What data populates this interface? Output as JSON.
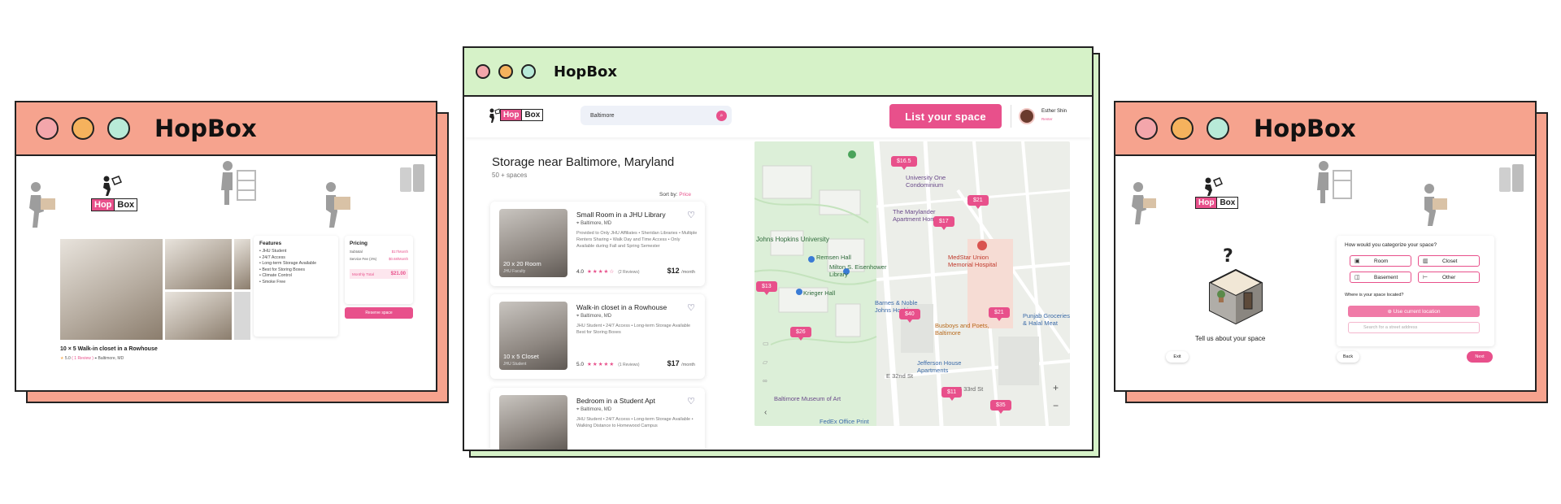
{
  "colors": {
    "brand_pink": "#e8508b",
    "salmon_window": "#f6a38e",
    "green_window": "#d6f2c8"
  },
  "logo": {
    "hop": "Hop",
    "box": "Box"
  },
  "left_window": {
    "title": "HopBox",
    "listing_title": "10 × 5 Walk-in closet in a Rowhouse",
    "listing_rating": "5.0",
    "listing_reviews": "1 Review",
    "listing_location": "Baltimore, MD",
    "features_title": "Features",
    "features": [
      "JHU Student",
      "24/7 Access",
      "Long-term Storage Available",
      "Best for Storing Boxes",
      "Climate Control",
      "Smoke Free"
    ],
    "pricing_title": "Pricing",
    "pricing_rows": [
      {
        "label": "Subtotal",
        "value": "$17/Month"
      },
      {
        "label": "Service Fee (4%)",
        "value": "$0.68/Month"
      }
    ],
    "pricing_total_label": "Monthly Total",
    "pricing_total_value": "$21.00",
    "reserve_label": "Reserve space"
  },
  "center_window": {
    "title": "HopBox",
    "search_value": "Baltimore",
    "search_icon": "search-icon",
    "list_space_label": "List your space",
    "user_name": "Esther Shin",
    "user_role": "Renter",
    "heading": "Storage near Baltimore, Maryland",
    "subheading": "50 + spaces",
    "sort_label": "Sort by:",
    "sort_value": "Price",
    "listings": [
      {
        "title": "Small Room in a JHU Library",
        "location": "Baltimore, MD",
        "description": "Provided to Only JHU Affiliates • Sheridan Libraries • Multiple Renters Sharing • Walk Day and Time Access • Only Available during Fall and Spring Semester",
        "rating": "4.0",
        "stars": "★★★★☆",
        "reviews": "(2 Reviews)",
        "price": "$12",
        "per": "/month",
        "thumb_caption": "20 x 20 Room",
        "thumb_sub": "JHU Faculty"
      },
      {
        "title": "Walk-in closet in a Rowhouse",
        "location": "Baltimore, MD",
        "description": "JHU Student • 24/7 Access • Long-term Storage Available Best for Storing Boxes",
        "rating": "5.0",
        "stars": "★★★★★",
        "reviews": "(1 Reviews)",
        "price": "$17",
        "per": "/month",
        "thumb_caption": "10 x 5 Closet",
        "thumb_sub": "JHU Student"
      },
      {
        "title": "Bedroom in a Student Apt",
        "location": "Baltimore, MD",
        "description": "JHU Student • 24/7 Access • Long-term Storage Available • Walking Distance to Homewood Campus",
        "rating": "",
        "stars": "",
        "reviews": "",
        "price": "",
        "per": "",
        "thumb_caption": "",
        "thumb_sub": ""
      }
    ],
    "map": {
      "labels": [
        {
          "key": "jhu",
          "text": "Johns Hopkins University"
        },
        {
          "key": "remsen",
          "text": "Remsen Hall"
        },
        {
          "key": "eisenhower",
          "text": "Milton S. Eisenhower Library"
        },
        {
          "key": "krieger",
          "text": "Krieger Hall"
        },
        {
          "key": "barnes",
          "text": "Barnes & Noble Johns Hopkins"
        },
        {
          "key": "busboys",
          "text": "Busboys and Poets, Baltimore"
        },
        {
          "key": "medstar",
          "text": "MedStar Union Memorial Hospital"
        },
        {
          "key": "marylander",
          "text": "The Marylander Apartment Homes"
        },
        {
          "key": "jefferson",
          "text": "Jefferson House Apartments"
        },
        {
          "key": "museum",
          "text": "Baltimore Museum of Art"
        },
        {
          "key": "punjab",
          "text": "Punjab Groceries & Halal Meat"
        },
        {
          "key": "fedex",
          "text": "FedEx Office Print"
        },
        {
          "key": "university_one",
          "text": "University One Condominium"
        },
        {
          "key": "e32",
          "text": "E 32nd St"
        },
        {
          "key": "e33",
          "text": "E 33rd St"
        }
      ],
      "pins": [
        "$16.5",
        "$21",
        "$17",
        "$13",
        "$40",
        "$21",
        "$26",
        "$11",
        "$35"
      ],
      "zoom_in": "+",
      "zoom_out": "−"
    }
  },
  "right_window": {
    "title": "HopBox",
    "tell_us": "Tell us about your space",
    "question": "How would you categorize your space?",
    "options": [
      "Room",
      "Closet",
      "Basement",
      "Other"
    ],
    "location_question": "Where is your space located?",
    "use_location": "Use current location",
    "address_placeholder": "Search for a street address",
    "exit_label": "Exit",
    "back_label": "Back",
    "next_label": "Next"
  }
}
